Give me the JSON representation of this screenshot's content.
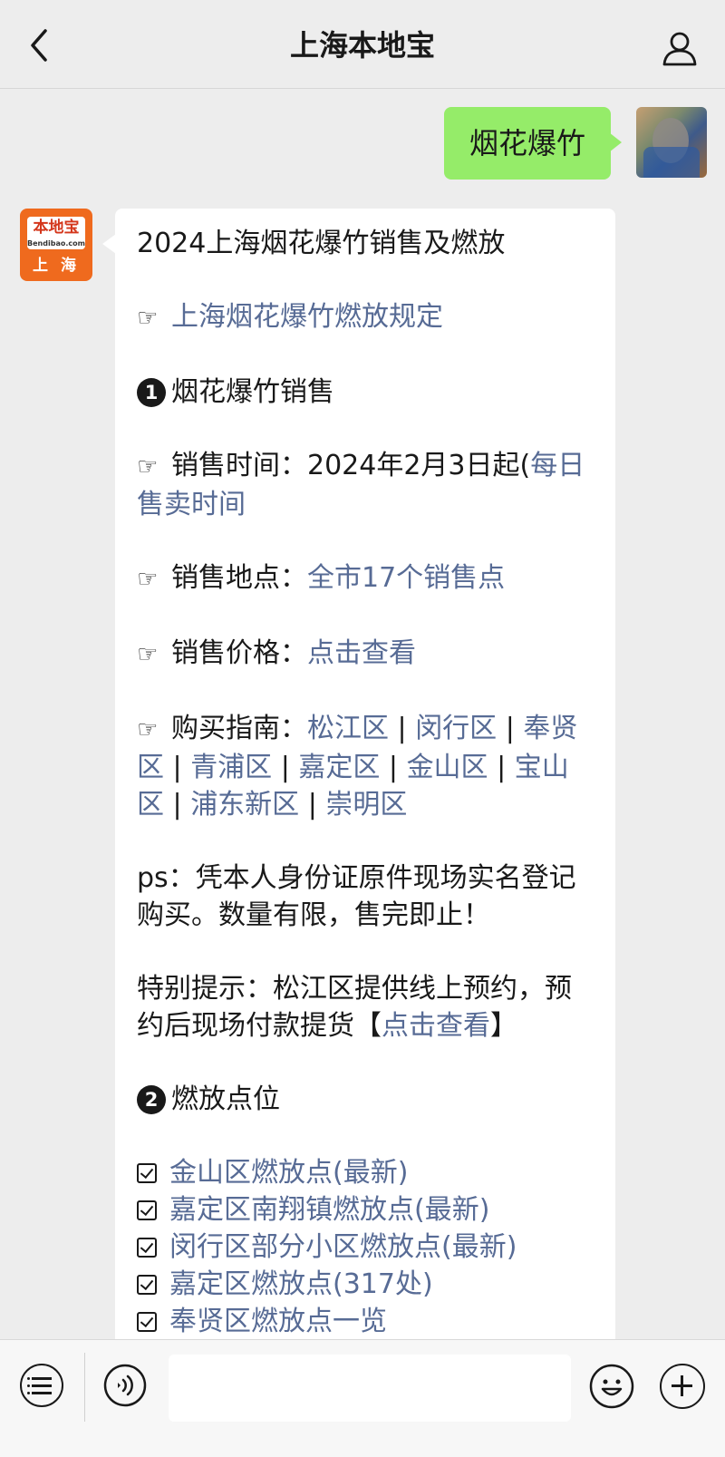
{
  "nav": {
    "title": "上海本地宝",
    "back_icon": "chevron-left-icon",
    "profile_icon": "person-icon"
  },
  "outgoing": {
    "text": "烟花爆竹"
  },
  "bot_avatar": {
    "brand": "本地宝",
    "sub": "Bendibao.com",
    "city": "上 海"
  },
  "reply": {
    "title": "2024上海烟花爆竹销售及燃放",
    "hand": "☞",
    "rules_link": "上海烟花爆竹燃放规定",
    "section1": {
      "num": "1",
      "label": "烟花爆竹销售"
    },
    "sale_time": {
      "label": "销售时间：",
      "value": "2024年2月3日起(",
      "link": "每日售卖时间"
    },
    "sale_place": {
      "label": "销售地点：",
      "link": "全市17个销售点"
    },
    "sale_price": {
      "label": "销售价格：",
      "link": "点击查看"
    },
    "guide": {
      "label": "购买指南：",
      "sep": " | ",
      "districts": [
        "松江区",
        "闵行区",
        "奉贤区",
        "青浦区",
        "嘉定区",
        "金山区",
        "宝山区",
        "浦东新区",
        "崇明区"
      ]
    },
    "ps": "ps：凭本人身份证原件现场实名登记购买。数量有限，售完即止！",
    "tip": {
      "text": "特别提示：松江区提供线上预约，预约后现场付款提货【",
      "link": "点击查看",
      "end": "】"
    },
    "section2": {
      "num": "2",
      "label": "燃放点位"
    },
    "spots": [
      "金山区燃放点(最新)",
      "嘉定区南翔镇燃放点(最新)",
      "闵行区部分小区燃放点(最新)",
      "嘉定区燃放点(317处)",
      "奉贤区燃放点一览"
    ]
  },
  "toolbar": {
    "menu_icon": "list-menu-icon",
    "voice_icon": "voice-icon",
    "emoji_icon": "emoji-icon",
    "plus_icon": "plus-icon"
  }
}
